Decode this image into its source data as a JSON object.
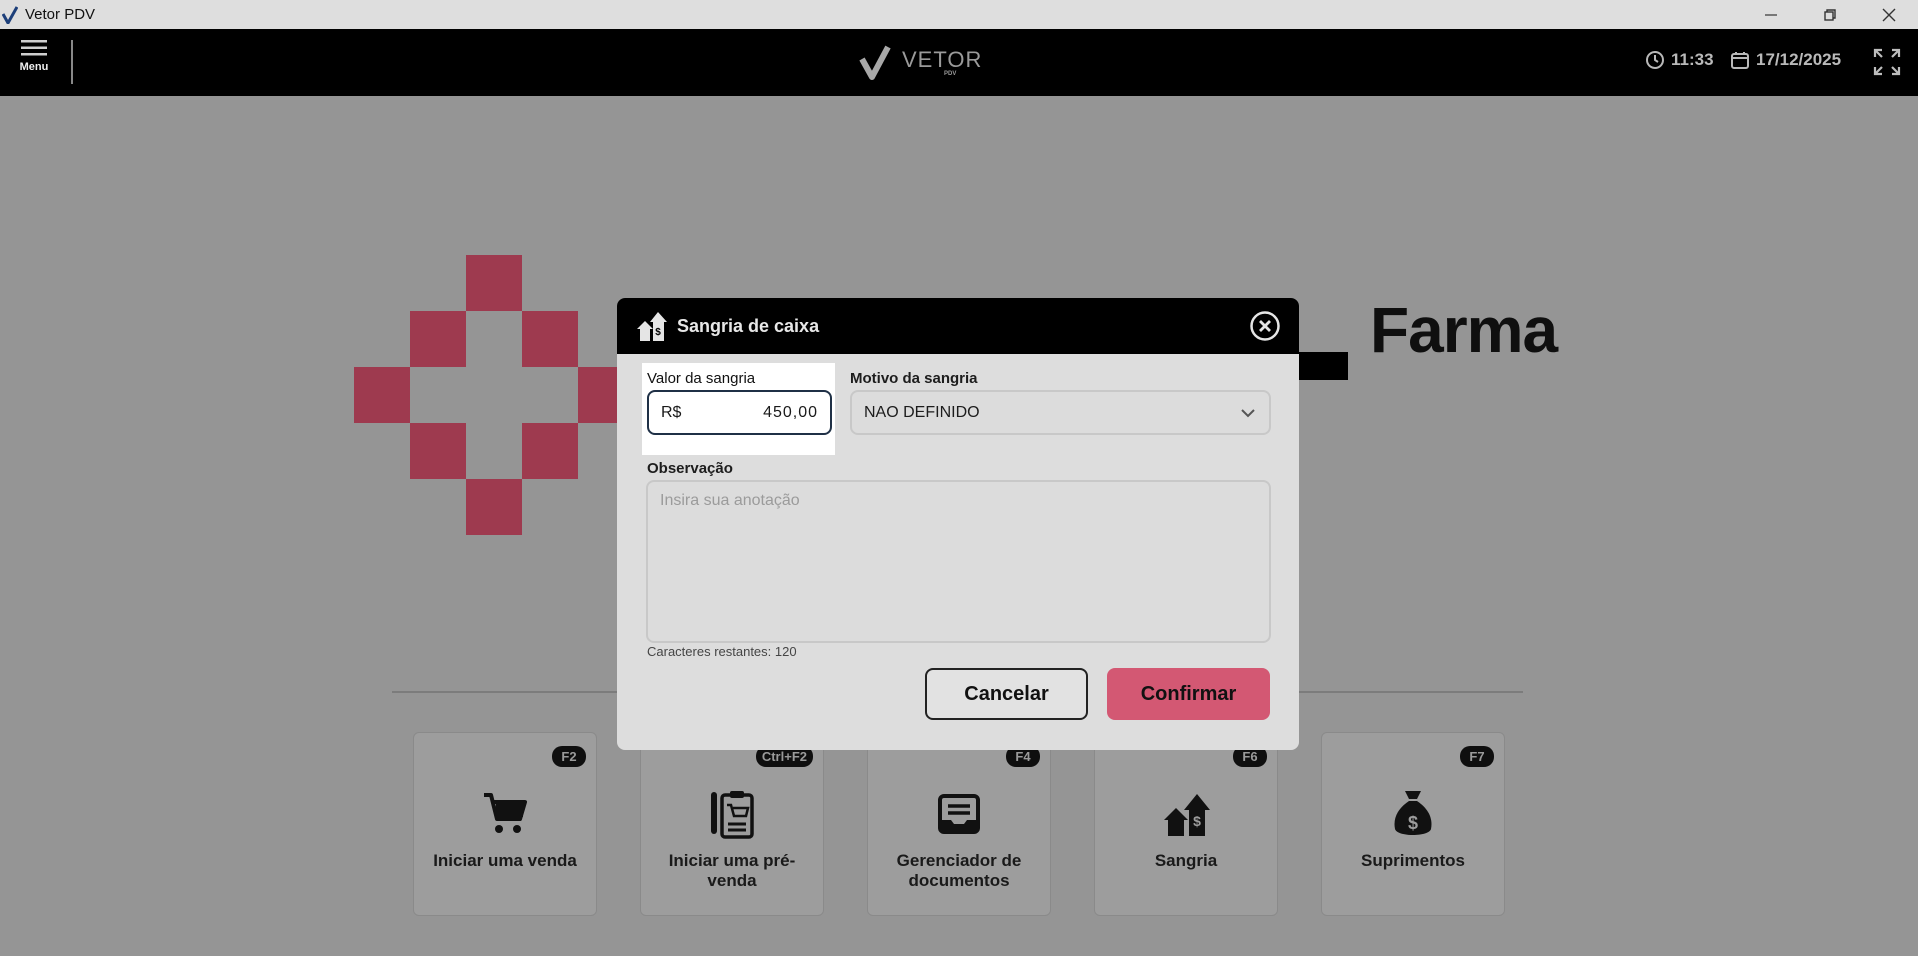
{
  "window": {
    "title": "Vetor PDV",
    "controls": [
      "minimize-icon",
      "restore-icon",
      "close-icon"
    ]
  },
  "appbar": {
    "menu_label": "Menu",
    "brand_name": "VETOR",
    "brand_sub": "PDV",
    "time": "11:33",
    "date": "17/12/2025"
  },
  "background": {
    "farma_text": "Farma",
    "actions": [
      {
        "label": "Iniciar uma venda",
        "shortcut": "F2",
        "icon": "cart-icon"
      },
      {
        "label": "Iniciar uma pré-venda",
        "shortcut": "Ctrl+F2",
        "icon": "clipboard-cart-icon"
      },
      {
        "label": "Gerenciador de documentos",
        "shortcut": "F4",
        "icon": "document-tray-icon"
      },
      {
        "label": "Sangria",
        "shortcut": "F6",
        "icon": "cash-withdraw-icon"
      },
      {
        "label": "Suprimentos",
        "shortcut": "F7",
        "icon": "money-bag-icon"
      }
    ]
  },
  "modal": {
    "title": "Sangria de caixa",
    "valor_label": "Valor da sangria",
    "currency": "R$",
    "valor_value": "450,00",
    "motivo_label": "Motivo da sangria",
    "motivo_value": "NAO DEFINIDO",
    "observacao_label": "Observação",
    "observacao_placeholder": "Insira sua anotação",
    "counter": "Caracteres restantes: 120",
    "cancel_label": "Cancelar",
    "confirm_label": "Confirmar"
  },
  "colors": {
    "accent": "#d35873",
    "logo_red": "#9e3a4f",
    "header_bg": "#000000",
    "overlay_bg": "#959595"
  }
}
